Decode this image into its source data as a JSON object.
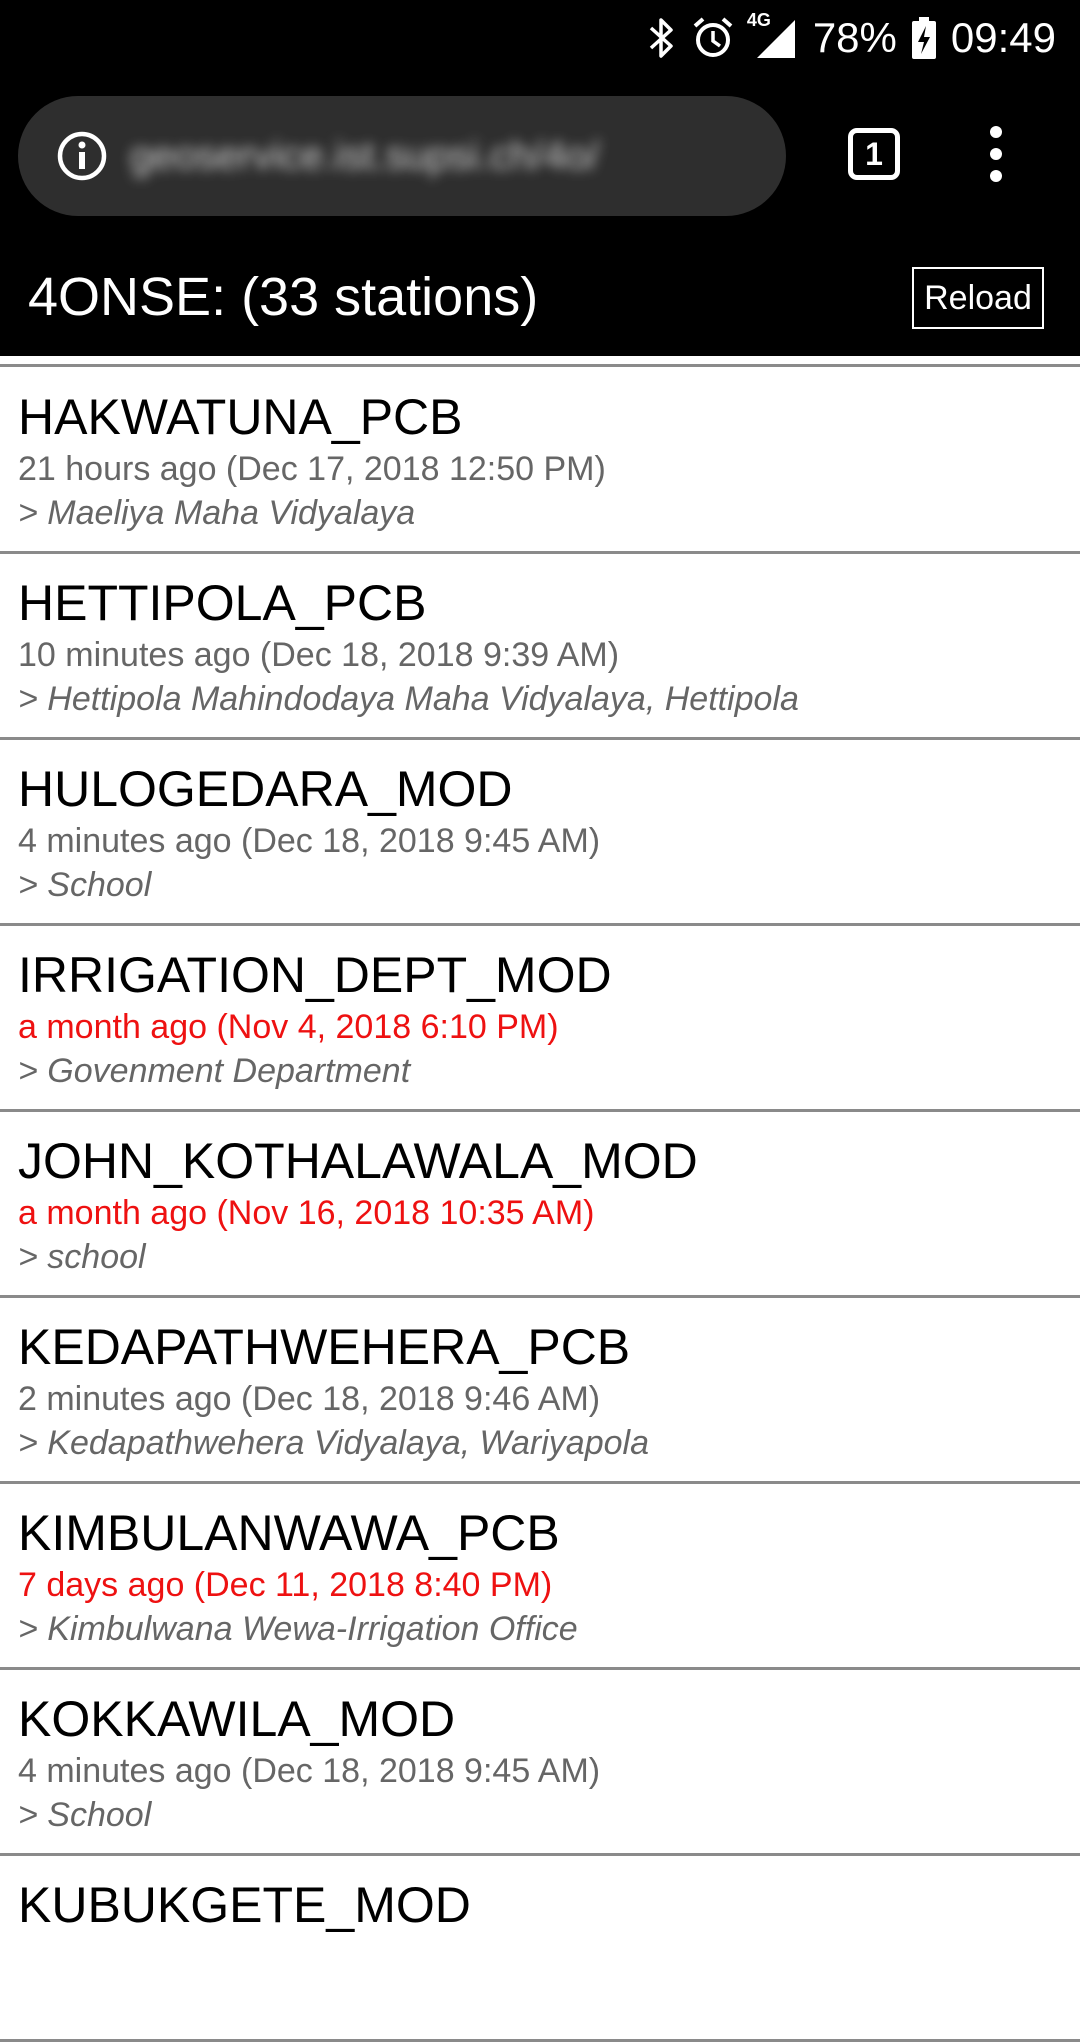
{
  "status_bar": {
    "network": "4G",
    "battery": "78%",
    "time": "09:49",
    "icons": [
      "bluetooth-icon",
      "alarm-icon",
      "signal-icon",
      "battery-charging-icon"
    ]
  },
  "browser": {
    "url": "geoservice.ist.supsi.ch/4o/",
    "tab_count": "1",
    "icons": [
      "info-icon",
      "more-vert-icon"
    ]
  },
  "header": {
    "title": "4ONSE: (33 stations)",
    "reload_label": "Reload"
  },
  "colors": {
    "stale_time": "#ee1111",
    "fresh_time": "#666666"
  },
  "stations": [
    {
      "name": "HAKWATUNA_PCB",
      "time": "21 hours ago (Dec 17, 2018 12:50 PM)",
      "location": "> Maeliya Maha Vidyalaya",
      "stale": false
    },
    {
      "name": "HETTIPOLA_PCB",
      "time": "10 minutes ago (Dec 18, 2018 9:39 AM)",
      "location": "> Hettipola Mahindodaya Maha Vidyalaya, Hettipola",
      "stale": false
    },
    {
      "name": "HULOGEDARA_MOD",
      "time": "4 minutes ago (Dec 18, 2018 9:45 AM)",
      "location": "> School",
      "stale": false
    },
    {
      "name": "IRRIGATION_DEPT_MOD",
      "time": "a month ago (Nov 4, 2018 6:10 PM)",
      "location": "> Govenment Department",
      "stale": true
    },
    {
      "name": "JOHN_KOTHALAWALA_MOD",
      "time": "a month ago (Nov 16, 2018 10:35 AM)",
      "location": "> school",
      "stale": true
    },
    {
      "name": "KEDAPATHWEHERA_PCB",
      "time": "2 minutes ago (Dec 18, 2018 9:46 AM)",
      "location": "> Kedapathwehera Vidyalaya, Wariyapola",
      "stale": false
    },
    {
      "name": "KIMBULANWAWA_PCB",
      "time": "7 days ago (Dec 11, 2018 8:40 PM)",
      "location": "> Kimbulwana Wewa-Irrigation Office",
      "stale": true
    },
    {
      "name": "KOKKAWILA_MOD",
      "time": "4 minutes ago (Dec 18, 2018 9:45 AM)",
      "location": "> School",
      "stale": false
    },
    {
      "name": "KUBUKGETE_MOD",
      "time": "",
      "location": "",
      "stale": false
    }
  ]
}
